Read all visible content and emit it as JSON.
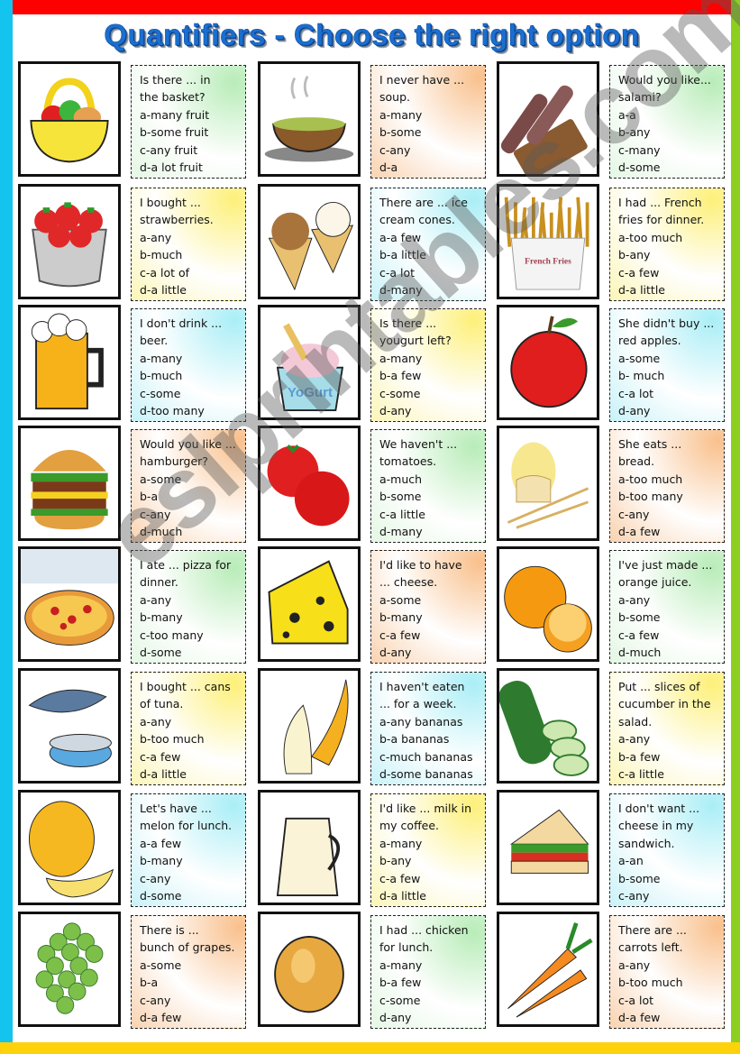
{
  "title": "Quantifiers - Choose the right option",
  "watermark": "eslprintables.com",
  "colors": {
    "frame_left": "#12c4ee",
    "frame_top": "#fe0000",
    "frame_right": "#8ccf1f",
    "frame_bottom": "#fdd20a",
    "title": "#1a6fd0"
  },
  "cards": [
    {
      "image": "fruit-basket",
      "lines": [
        "Is there ... in",
        "the basket?",
        "a-many fruit",
        "b-some fruit",
        "c-any fruit",
        "d-a lot fruit"
      ]
    },
    {
      "image": "soup-bowl",
      "lines": [
        "I never have ...",
        "soup.",
        "a-many",
        "b-some",
        "c-any",
        "d-a"
      ]
    },
    {
      "image": "salami",
      "lines": [
        "Would you like...",
        "salami?",
        "a-a",
        "b-any",
        "c-many",
        "d-some"
      ]
    },
    {
      "image": "strawberries",
      "lines": [
        "I bought ...",
        "strawberries.",
        "a-any",
        "b-much",
        "c-a lot of",
        "d-a little"
      ]
    },
    {
      "image": "ice-cream-cones",
      "lines": [
        "There are  ... ice",
        "cream cones.",
        "a-a few",
        "b-a little",
        "c-a lot",
        "d-many"
      ]
    },
    {
      "image": "french-fries",
      "label": "French Fries",
      "lines": [
        "I had ... French",
        "fries for dinner.",
        "a-too much",
        "b-any",
        "c-a few",
        "d-a little"
      ]
    },
    {
      "image": "beer-mug",
      "lines": [
        "I don't drink ...",
        "beer.",
        "a-many",
        "b-much",
        "c-some",
        "d-too many"
      ]
    },
    {
      "image": "yogurt",
      "label": "YoGurt",
      "lines": [
        "Is there ...",
        "yougurt left?",
        "a-many",
        "b-a few",
        "c-some",
        "d-any"
      ]
    },
    {
      "image": "red-apple",
      "lines": [
        "She didn't buy ...",
        "red apples.",
        "a-some",
        "b- much",
        "c-a lot",
        "d-any"
      ]
    },
    {
      "image": "hamburger",
      "lines": [
        "Would you like ...",
        "hamburger?",
        "a-some",
        "b-a",
        "c-any",
        "d-much"
      ]
    },
    {
      "image": "tomatoes",
      "lines": [
        "We haven't ...",
        "tomatoes.",
        "a-much",
        "b-some",
        "c-a little",
        "d-many"
      ]
    },
    {
      "image": "bread",
      "lines": [
        "She eats ...",
        "bread.",
        "a-too much",
        "b-too many",
        "c-any",
        "d-a few"
      ]
    },
    {
      "image": "pizza",
      "lines": [
        "I ate ... pizza for",
        "dinner.",
        "a-any",
        "b-many",
        "c-too many",
        "d-some"
      ]
    },
    {
      "image": "cheese",
      "lines": [
        "I'd like to have",
        "... cheese.",
        "a-some",
        "b-many",
        "c-a few",
        "d-any"
      ]
    },
    {
      "image": "oranges",
      "lines": [
        "I've just made ...",
        "orange juice.",
        "a-any",
        "b-some",
        "c-a few",
        "d-much"
      ]
    },
    {
      "image": "tuna",
      "lines": [
        "I bought ... cans",
        "of tuna.",
        "a-any",
        "b-too much",
        "c-a few",
        "d-a little"
      ]
    },
    {
      "image": "banana",
      "lines": [
        "I haven't eaten",
        "... for a week.",
        "a-any bananas",
        "b-a bananas",
        "c-much bananas",
        "d-some bananas"
      ]
    },
    {
      "image": "cucumber",
      "lines": [
        "Put ... slices of",
        "cucumber in the",
        "salad.",
        "a-any",
        "b-a few",
        "c-a little"
      ]
    },
    {
      "image": "melon",
      "lines": [
        "Let's have ...",
        "melon for lunch.",
        "a-a few",
        "b-many",
        "c-any",
        "d-some"
      ]
    },
    {
      "image": "milk-jug",
      "lines": [
        "I'd like ... milk in",
        "my coffee.",
        "a-many",
        "b-any",
        "c-a few",
        "d-a little"
      ]
    },
    {
      "image": "sandwich",
      "lines": [
        "I don't want ...",
        "cheese in my",
        "sandwich.",
        "a-an",
        "b-some",
        "c-any"
      ]
    },
    {
      "image": "grapes",
      "lines": [
        "There is ...",
        "bunch of grapes.",
        "a-some",
        "b-a",
        "c-any",
        "d-a few"
      ]
    },
    {
      "image": "roast-chicken",
      "lines": [
        "I had ... chicken",
        "for lunch.",
        "a-many",
        "b-a few",
        "c-some",
        "d-any"
      ]
    },
    {
      "image": "carrots",
      "lines": [
        "There are ...",
        "carrots left.",
        "a-any",
        "b-too much",
        "c-a lot",
        "d-a few"
      ]
    }
  ]
}
